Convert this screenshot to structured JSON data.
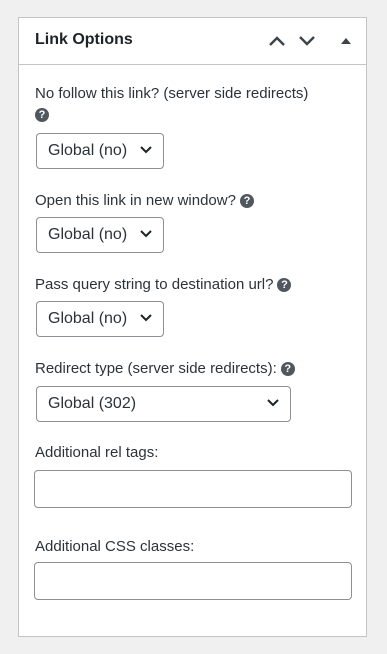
{
  "panel": {
    "title": "Link Options"
  },
  "fields": {
    "nofollow": {
      "label": "No follow this link? (server side redirects)",
      "help": "?",
      "value": "Global (no)"
    },
    "new_window": {
      "label": "Open this link in new window?",
      "help": "?",
      "value": "Global (no)"
    },
    "query_string": {
      "label": "Pass query string to destination url?",
      "help": "?",
      "value": "Global (no)"
    },
    "redirect_type": {
      "label": "Redirect type (server side redirects):",
      "help": "?",
      "value": "Global (302)"
    },
    "rel_tags": {
      "label": "Additional rel tags:",
      "value": ""
    },
    "css_classes": {
      "label": "Additional CSS classes:",
      "value": ""
    }
  },
  "icons": {
    "move_up": "chevron-up-icon",
    "move_down": "chevron-down-icon",
    "toggle": "triangle-up-icon",
    "help": "question-circle-icon",
    "select_arrow": "chevron-down-icon"
  },
  "colors": {
    "border": "#c3c4c7",
    "text": "#1d2327",
    "help_icon": "#50575e"
  }
}
